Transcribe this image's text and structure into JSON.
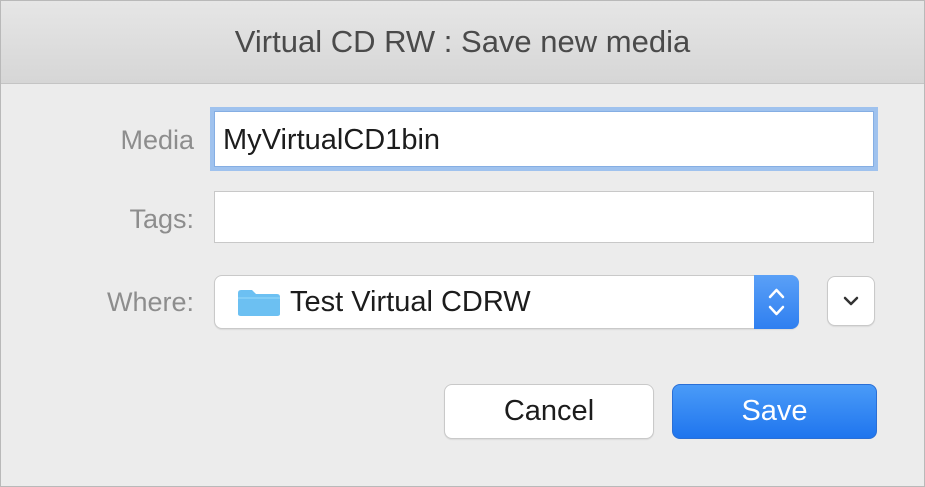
{
  "window": {
    "title": "Virtual CD RW : Save new media"
  },
  "form": {
    "media_label": "Media",
    "media_value": "MyVirtualCD1bin",
    "tags_label": "Tags:",
    "tags_value": "",
    "where_label": "Where:",
    "where_value": "Test Virtual CDRW",
    "where_icon": "folder-icon"
  },
  "buttons": {
    "cancel_label": "Cancel",
    "save_label": "Save"
  },
  "colors": {
    "accent": "#1f75ee",
    "focus_ring": "#9fc2ee",
    "folder": "#6cc0f2"
  }
}
